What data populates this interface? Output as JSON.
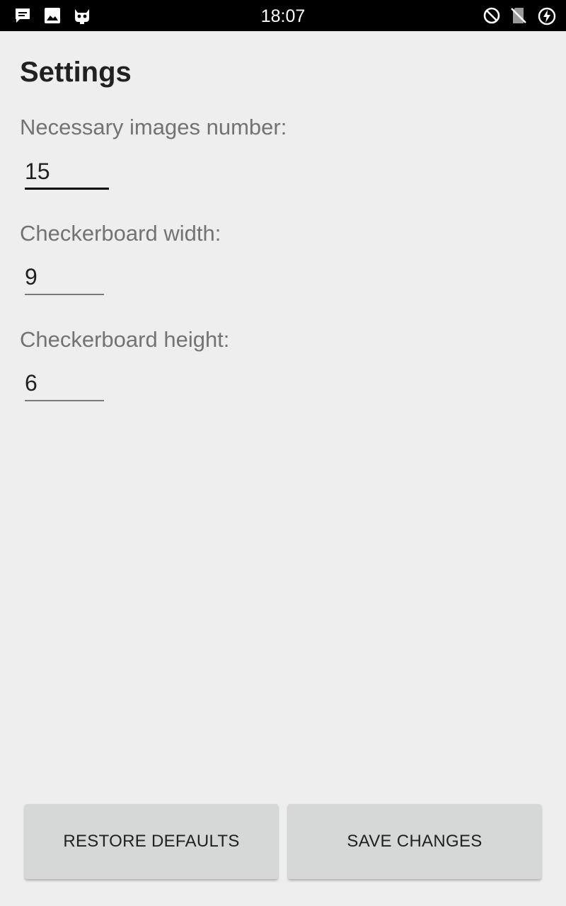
{
  "status_bar": {
    "time": "18:07",
    "left_icons": [
      "message-icon",
      "image-icon",
      "cyanogen-icon"
    ],
    "right_icons": [
      "do-not-disturb-icon",
      "no-sim-icon",
      "battery-charging-icon"
    ]
  },
  "settings": {
    "title": "Settings",
    "fields": [
      {
        "label": "Necessary images number:",
        "value": "15"
      },
      {
        "label": "Checkerboard width:",
        "value": "9"
      },
      {
        "label": "Checkerboard height:",
        "value": "6"
      }
    ]
  },
  "buttons": {
    "restore": "RESTORE DEFAULTS",
    "save": "SAVE CHANGES"
  },
  "colors": {
    "background": "#eeeeee",
    "status_bar": "#000000",
    "button": "#d6d7d7",
    "label_text": "#737373"
  }
}
